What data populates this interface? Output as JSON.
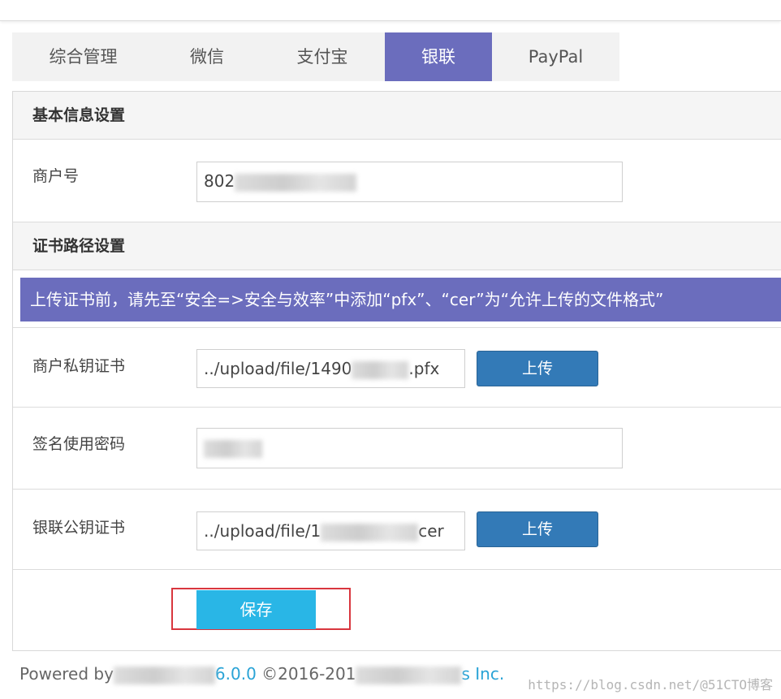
{
  "tabs": [
    {
      "label": "综合管理",
      "active": false
    },
    {
      "label": "微信",
      "active": false
    },
    {
      "label": "支付宝",
      "active": false
    },
    {
      "label": "银联",
      "active": true
    },
    {
      "label": "PayPal",
      "active": false
    }
  ],
  "basic_section": {
    "title": "基本信息设置",
    "merchant_label": "商户号",
    "merchant_value": "802"
  },
  "cert_section": {
    "title": "证书路径设置",
    "notice": "上传证书前，请先至“安全=>安全与效率”中添加“pfx”、“cer”为“允许上传的文件格式”",
    "private_cert_label": "商户私钥证书",
    "private_cert_value_prefix": "../upload/file/1490",
    "private_cert_value_suffix": ".pfx",
    "sign_password_label": "签名使用密码",
    "public_cert_label": "银联公钥证书",
    "public_cert_value_prefix": "../upload/file/1",
    "public_cert_value_suffix": "cer",
    "upload_label": "上传"
  },
  "save_label": "保存",
  "footer": {
    "powered_by": "Powered by",
    "version": "6.0.0",
    "copyright": "©2016-201",
    "company_suffix": "s Inc."
  },
  "watermark": "https://blog.csdn.net/@51CTO博客",
  "colors": {
    "tab_active": "#6b6dbd",
    "notice_bg": "#6b6dbd",
    "upload_button": "#337ab7",
    "save_button": "#29b6e6",
    "highlight_border": "#d9363e"
  }
}
